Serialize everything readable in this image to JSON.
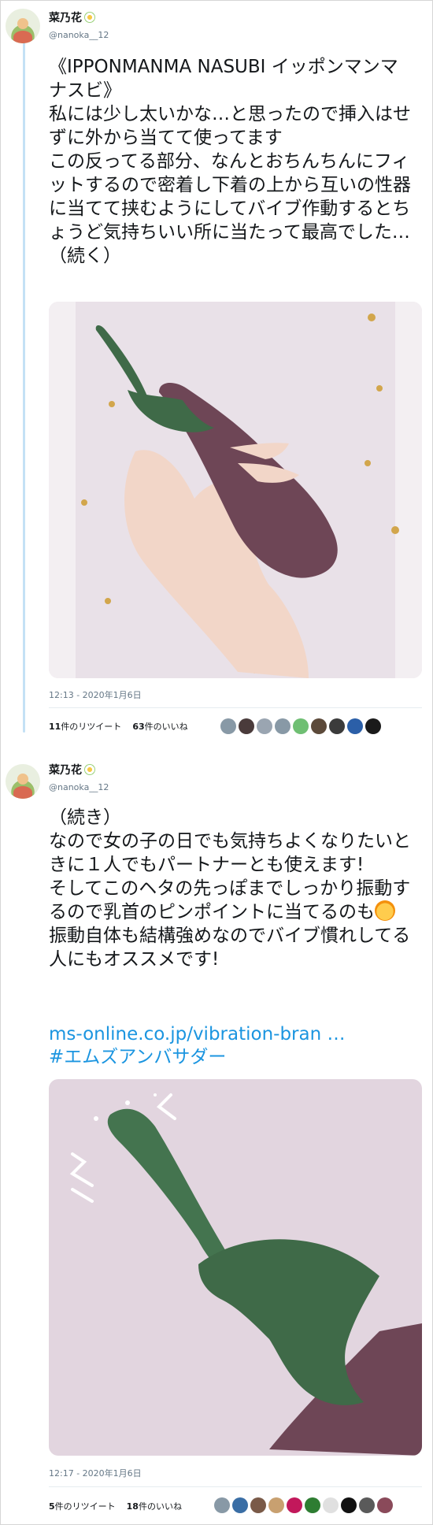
{
  "colors": {
    "accent": "#1b95e0",
    "thread_line": "#c4e1f5",
    "muted": "#657786"
  },
  "tweets": [
    {
      "name": "菜乃花",
      "name_icon": "flower-icon",
      "handle": "@nanoka__12",
      "text": "《IPPONMANMA NASUBI イッポンマンマ ナスビ》\n私には少し太いかな…と思ったので挿入はせずに外から当てて使ってます\nこの反ってる部分、なんとおちんちんにフィットするので密着し下着の上から互いの性器に当てて挟むようにしてバイブ作動するとちょうど気持ちいい所に当たって最高でした…\n（続く）",
      "time": "12:13 - 2020年1月6日",
      "retweets_count": "11",
      "retweets_label": "件のリツイート",
      "likes_count": "63",
      "likes_label": "件のいいね"
    },
    {
      "name": "菜乃花",
      "name_icon": "flower-icon",
      "handle": "@nanoka__12",
      "text_before_emoji": "（続き）\nなので女の子の日でも気持ちよくなりたいときに１人でもパートナーとも使えます!\nそしてこのヘタの先っぽまでしっかり振動するので乳首のピンポイントに当てるのも",
      "emoji": "woman-gesturing-emoji",
      "text_after_emoji": "\n振動自体も結構強めなのでバイブ慣れしてる人にもオススメです!",
      "link": "ms-online.co.jp/vibration-bran …",
      "hashtag": "#エムズアンバサダー",
      "time": "12:17 - 2020年1月6日",
      "retweets_count": "5",
      "retweets_label": "件のリツイート",
      "likes_count": "18",
      "likes_label": "件のいいね"
    }
  ]
}
